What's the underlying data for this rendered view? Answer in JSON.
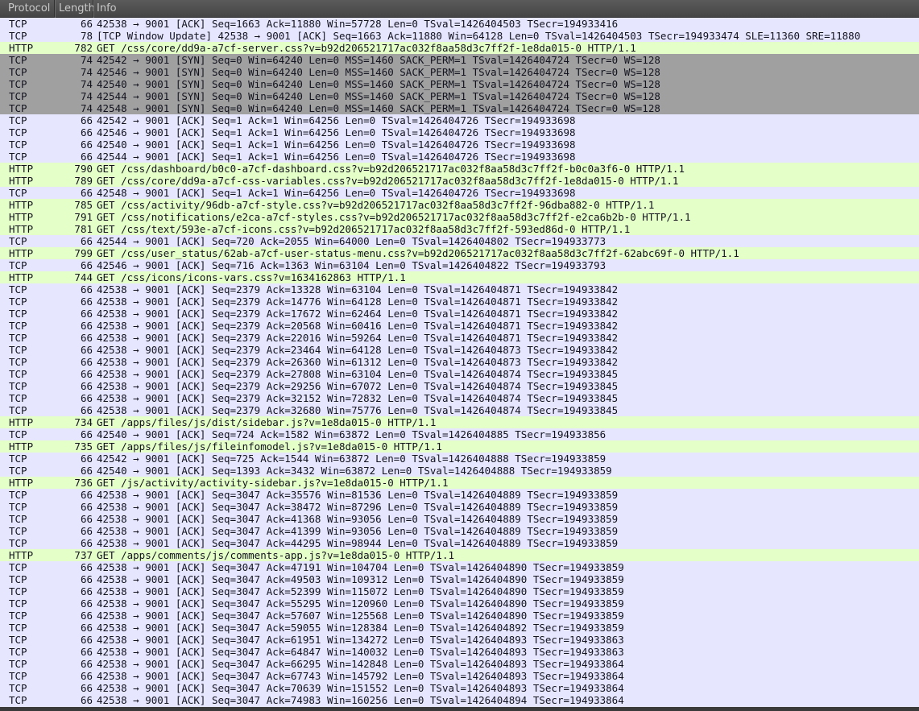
{
  "columns": {
    "protocol": "Protocol",
    "length": "Length",
    "info": "Info"
  },
  "colors": {
    "tcp": "#e7e6ff",
    "http": "#e4ffc7",
    "syn": "#a0a0a0",
    "header": "#4f4f4f"
  },
  "packets": [
    {
      "protocol": "TCP",
      "length": "66",
      "info": "42538 → 9001 [ACK] Seq=1663 Ack=11880 Win=57728 Len=0 TSval=1426404503 TSecr=194933416",
      "style": "tcp"
    },
    {
      "protocol": "TCP",
      "length": "78",
      "info": "[TCP Window Update] 42538 → 9001 [ACK] Seq=1663 Ack=11880 Win=64128 Len=0 TSval=1426404503 TSecr=194933474 SLE=11360 SRE=11880",
      "style": "tcp"
    },
    {
      "protocol": "HTTP",
      "length": "782",
      "info": "GET /css/core/dd9a-a7cf-server.css?v=b92d206521717ac032f8aa58d3c7ff2f-1e8da015-0 HTTP/1.1",
      "style": "http"
    },
    {
      "protocol": "TCP",
      "length": "74",
      "info": "42542 → 9001 [SYN] Seq=0 Win=64240 Len=0 MSS=1460 SACK_PERM=1 TSval=1426404724 TSecr=0 WS=128",
      "style": "syn"
    },
    {
      "protocol": "TCP",
      "length": "74",
      "info": "42546 → 9001 [SYN] Seq=0 Win=64240 Len=0 MSS=1460 SACK_PERM=1 TSval=1426404724 TSecr=0 WS=128",
      "style": "syn"
    },
    {
      "protocol": "TCP",
      "length": "74",
      "info": "42540 → 9001 [SYN] Seq=0 Win=64240 Len=0 MSS=1460 SACK_PERM=1 TSval=1426404724 TSecr=0 WS=128",
      "style": "syn"
    },
    {
      "protocol": "TCP",
      "length": "74",
      "info": "42544 → 9001 [SYN] Seq=0 Win=64240 Len=0 MSS=1460 SACK_PERM=1 TSval=1426404724 TSecr=0 WS=128",
      "style": "syn"
    },
    {
      "protocol": "TCP",
      "length": "74",
      "info": "42548 → 9001 [SYN] Seq=0 Win=64240 Len=0 MSS=1460 SACK_PERM=1 TSval=1426404724 TSecr=0 WS=128",
      "style": "syn"
    },
    {
      "protocol": "TCP",
      "length": "66",
      "info": "42542 → 9001 [ACK] Seq=1 Ack=1 Win=64256 Len=0 TSval=1426404726 TSecr=194933698",
      "style": "tcp"
    },
    {
      "protocol": "TCP",
      "length": "66",
      "info": "42546 → 9001 [ACK] Seq=1 Ack=1 Win=64256 Len=0 TSval=1426404726 TSecr=194933698",
      "style": "tcp"
    },
    {
      "protocol": "TCP",
      "length": "66",
      "info": "42540 → 9001 [ACK] Seq=1 Ack=1 Win=64256 Len=0 TSval=1426404726 TSecr=194933698",
      "style": "tcp"
    },
    {
      "protocol": "TCP",
      "length": "66",
      "info": "42544 → 9001 [ACK] Seq=1 Ack=1 Win=64256 Len=0 TSval=1426404726 TSecr=194933698",
      "style": "tcp"
    },
    {
      "protocol": "HTTP",
      "length": "790",
      "info": "GET /css/dashboard/b0c0-a7cf-dashboard.css?v=b92d206521717ac032f8aa58d3c7ff2f-b0c0a3f6-0 HTTP/1.1",
      "style": "http"
    },
    {
      "protocol": "HTTP",
      "length": "789",
      "info": "GET /css/core/dd9a-a7cf-css-variables.css?v=b92d206521717ac032f8aa58d3c7ff2f-1e8da015-0 HTTP/1.1",
      "style": "http"
    },
    {
      "protocol": "TCP",
      "length": "66",
      "info": "42548 → 9001 [ACK] Seq=1 Ack=1 Win=64256 Len=0 TSval=1426404726 TSecr=194933698",
      "style": "tcp"
    },
    {
      "protocol": "HTTP",
      "length": "785",
      "info": "GET /css/activity/96db-a7cf-style.css?v=b92d206521717ac032f8aa58d3c7ff2f-96dba882-0 HTTP/1.1",
      "style": "http"
    },
    {
      "protocol": "HTTP",
      "length": "791",
      "info": "GET /css/notifications/e2ca-a7cf-styles.css?v=b92d206521717ac032f8aa58d3c7ff2f-e2ca6b2b-0 HTTP/1.1",
      "style": "http"
    },
    {
      "protocol": "HTTP",
      "length": "781",
      "info": "GET /css/text/593e-a7cf-icons.css?v=b92d206521717ac032f8aa58d3c7ff2f-593ed86d-0 HTTP/1.1",
      "style": "http"
    },
    {
      "protocol": "TCP",
      "length": "66",
      "info": "42544 → 9001 [ACK] Seq=720 Ack=2055 Win=64000 Len=0 TSval=1426404802 TSecr=194933773",
      "style": "tcp"
    },
    {
      "protocol": "HTTP",
      "length": "799",
      "info": "GET /css/user_status/62ab-a7cf-user-status-menu.css?v=b92d206521717ac032f8aa58d3c7ff2f-62abc69f-0 HTTP/1.1",
      "style": "http"
    },
    {
      "protocol": "TCP",
      "length": "66",
      "info": "42546 → 9001 [ACK] Seq=716 Ack=1363 Win=63104 Len=0 TSval=1426404822 TSecr=194933793",
      "style": "tcp"
    },
    {
      "protocol": "HTTP",
      "length": "744",
      "info": "GET /css/icons/icons-vars.css?v=1634162863 HTTP/1.1",
      "style": "http"
    },
    {
      "protocol": "TCP",
      "length": "66",
      "info": "42538 → 9001 [ACK] Seq=2379 Ack=13328 Win=63104 Len=0 TSval=1426404871 TSecr=194933842",
      "style": "tcp"
    },
    {
      "protocol": "TCP",
      "length": "66",
      "info": "42538 → 9001 [ACK] Seq=2379 Ack=14776 Win=64128 Len=0 TSval=1426404871 TSecr=194933842",
      "style": "tcp"
    },
    {
      "protocol": "TCP",
      "length": "66",
      "info": "42538 → 9001 [ACK] Seq=2379 Ack=17672 Win=62464 Len=0 TSval=1426404871 TSecr=194933842",
      "style": "tcp"
    },
    {
      "protocol": "TCP",
      "length": "66",
      "info": "42538 → 9001 [ACK] Seq=2379 Ack=20568 Win=60416 Len=0 TSval=1426404871 TSecr=194933842",
      "style": "tcp"
    },
    {
      "protocol": "TCP",
      "length": "66",
      "info": "42538 → 9001 [ACK] Seq=2379 Ack=22016 Win=59264 Len=0 TSval=1426404871 TSecr=194933842",
      "style": "tcp"
    },
    {
      "protocol": "TCP",
      "length": "66",
      "info": "42538 → 9001 [ACK] Seq=2379 Ack=23464 Win=64128 Len=0 TSval=1426404873 TSecr=194933842",
      "style": "tcp"
    },
    {
      "protocol": "TCP",
      "length": "66",
      "info": "42538 → 9001 [ACK] Seq=2379 Ack=26360 Win=61312 Len=0 TSval=1426404873 TSecr=194933842",
      "style": "tcp"
    },
    {
      "protocol": "TCP",
      "length": "66",
      "info": "42538 → 9001 [ACK] Seq=2379 Ack=27808 Win=63104 Len=0 TSval=1426404874 TSecr=194933845",
      "style": "tcp"
    },
    {
      "protocol": "TCP",
      "length": "66",
      "info": "42538 → 9001 [ACK] Seq=2379 Ack=29256 Win=67072 Len=0 TSval=1426404874 TSecr=194933845",
      "style": "tcp"
    },
    {
      "protocol": "TCP",
      "length": "66",
      "info": "42538 → 9001 [ACK] Seq=2379 Ack=32152 Win=72832 Len=0 TSval=1426404874 TSecr=194933845",
      "style": "tcp"
    },
    {
      "protocol": "TCP",
      "length": "66",
      "info": "42538 → 9001 [ACK] Seq=2379 Ack=32680 Win=75776 Len=0 TSval=1426404874 TSecr=194933845",
      "style": "tcp"
    },
    {
      "protocol": "HTTP",
      "length": "734",
      "info": "GET /apps/files/js/dist/sidebar.js?v=1e8da015-0 HTTP/1.1",
      "style": "http"
    },
    {
      "protocol": "TCP",
      "length": "66",
      "info": "42540 → 9001 [ACK] Seq=724 Ack=1582 Win=63872 Len=0 TSval=1426404885 TSecr=194933856",
      "style": "tcp"
    },
    {
      "protocol": "HTTP",
      "length": "735",
      "info": "GET /apps/files/js/fileinfomodel.js?v=1e8da015-0 HTTP/1.1",
      "style": "http"
    },
    {
      "protocol": "TCP",
      "length": "66",
      "info": "42542 → 9001 [ACK] Seq=725 Ack=1544 Win=63872 Len=0 TSval=1426404888 TSecr=194933859",
      "style": "tcp"
    },
    {
      "protocol": "TCP",
      "length": "66",
      "info": "42540 → 9001 [ACK] Seq=1393 Ack=3432 Win=63872 Len=0 TSval=1426404888 TSecr=194933859",
      "style": "tcp"
    },
    {
      "protocol": "HTTP",
      "length": "736",
      "info": "GET /js/activity/activity-sidebar.js?v=1e8da015-0 HTTP/1.1",
      "style": "http"
    },
    {
      "protocol": "TCP",
      "length": "66",
      "info": "42538 → 9001 [ACK] Seq=3047 Ack=35576 Win=81536 Len=0 TSval=1426404889 TSecr=194933859",
      "style": "tcp"
    },
    {
      "protocol": "TCP",
      "length": "66",
      "info": "42538 → 9001 [ACK] Seq=3047 Ack=38472 Win=87296 Len=0 TSval=1426404889 TSecr=194933859",
      "style": "tcp"
    },
    {
      "protocol": "TCP",
      "length": "66",
      "info": "42538 → 9001 [ACK] Seq=3047 Ack=41368 Win=93056 Len=0 TSval=1426404889 TSecr=194933859",
      "style": "tcp"
    },
    {
      "protocol": "TCP",
      "length": "66",
      "info": "42538 → 9001 [ACK] Seq=3047 Ack=41399 Win=93056 Len=0 TSval=1426404889 TSecr=194933859",
      "style": "tcp"
    },
    {
      "protocol": "TCP",
      "length": "66",
      "info": "42538 → 9001 [ACK] Seq=3047 Ack=44295 Win=98944 Len=0 TSval=1426404889 TSecr=194933859",
      "style": "tcp"
    },
    {
      "protocol": "HTTP",
      "length": "737",
      "info": "GET /apps/comments/js/comments-app.js?v=1e8da015-0 HTTP/1.1",
      "style": "http"
    },
    {
      "protocol": "TCP",
      "length": "66",
      "info": "42538 → 9001 [ACK] Seq=3047 Ack=47191 Win=104704 Len=0 TSval=1426404890 TSecr=194933859",
      "style": "tcp"
    },
    {
      "protocol": "TCP",
      "length": "66",
      "info": "42538 → 9001 [ACK] Seq=3047 Ack=49503 Win=109312 Len=0 TSval=1426404890 TSecr=194933859",
      "style": "tcp"
    },
    {
      "protocol": "TCP",
      "length": "66",
      "info": "42538 → 9001 [ACK] Seq=3047 Ack=52399 Win=115072 Len=0 TSval=1426404890 TSecr=194933859",
      "style": "tcp"
    },
    {
      "protocol": "TCP",
      "length": "66",
      "info": "42538 → 9001 [ACK] Seq=3047 Ack=55295 Win=120960 Len=0 TSval=1426404890 TSecr=194933859",
      "style": "tcp"
    },
    {
      "protocol": "TCP",
      "length": "66",
      "info": "42538 → 9001 [ACK] Seq=3047 Ack=57607 Win=125568 Len=0 TSval=1426404890 TSecr=194933859",
      "style": "tcp"
    },
    {
      "protocol": "TCP",
      "length": "66",
      "info": "42538 → 9001 [ACK] Seq=3047 Ack=59055 Win=128384 Len=0 TSval=1426404892 TSecr=194933859",
      "style": "tcp"
    },
    {
      "protocol": "TCP",
      "length": "66",
      "info": "42538 → 9001 [ACK] Seq=3047 Ack=61951 Win=134272 Len=0 TSval=1426404893 TSecr=194933863",
      "style": "tcp"
    },
    {
      "protocol": "TCP",
      "length": "66",
      "info": "42538 → 9001 [ACK] Seq=3047 Ack=64847 Win=140032 Len=0 TSval=1426404893 TSecr=194933863",
      "style": "tcp"
    },
    {
      "protocol": "TCP",
      "length": "66",
      "info": "42538 → 9001 [ACK] Seq=3047 Ack=66295 Win=142848 Len=0 TSval=1426404893 TSecr=194933864",
      "style": "tcp"
    },
    {
      "protocol": "TCP",
      "length": "66",
      "info": "42538 → 9001 [ACK] Seq=3047 Ack=67743 Win=145792 Len=0 TSval=1426404893 TSecr=194933864",
      "style": "tcp"
    },
    {
      "protocol": "TCP",
      "length": "66",
      "info": "42538 → 9001 [ACK] Seq=3047 Ack=70639 Win=151552 Len=0 TSval=1426404893 TSecr=194933864",
      "style": "tcp"
    },
    {
      "protocol": "TCP",
      "length": "66",
      "info": "42538 → 9001 [ACK] Seq=3047 Ack=74983 Win=160256 Len=0 TSval=1426404894 TSecr=194933864",
      "style": "tcp"
    }
  ]
}
